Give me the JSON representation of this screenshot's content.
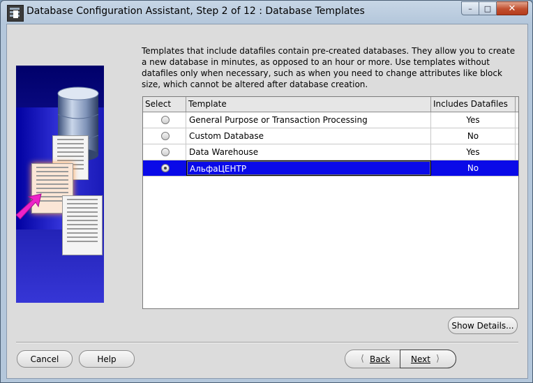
{
  "window": {
    "title": "Database Configuration Assistant, Step 2 of 12 : Database Templates",
    "icons": [
      "app-icon",
      "minimize-icon",
      "maximize-icon",
      "close-icon"
    ]
  },
  "description": "Templates that include datafiles contain pre-created databases. They allow you to create a new database in minutes, as opposed to an hour or more. Use templates without datafiles only when necessary, such as when you need to change attributes like block size, which cannot be altered after database creation.",
  "table": {
    "columns": [
      "Select",
      "Template",
      "Includes Datafiles"
    ],
    "rows": [
      {
        "template": "General Purpose or Transaction Processing",
        "includes": "Yes",
        "selected": false
      },
      {
        "template": "Custom Database",
        "includes": "No",
        "selected": false
      },
      {
        "template": "Data Warehouse",
        "includes": "Yes",
        "selected": false
      },
      {
        "template": "АльфаЦЕНТР",
        "includes": "No",
        "selected": true
      }
    ]
  },
  "buttons": {
    "show_details": "Show Details...",
    "cancel": "Cancel",
    "help": "Help",
    "back": "Back",
    "next": "Next"
  },
  "colors": {
    "selection": "#0a0ae8",
    "close_button": "#c14f2f"
  }
}
